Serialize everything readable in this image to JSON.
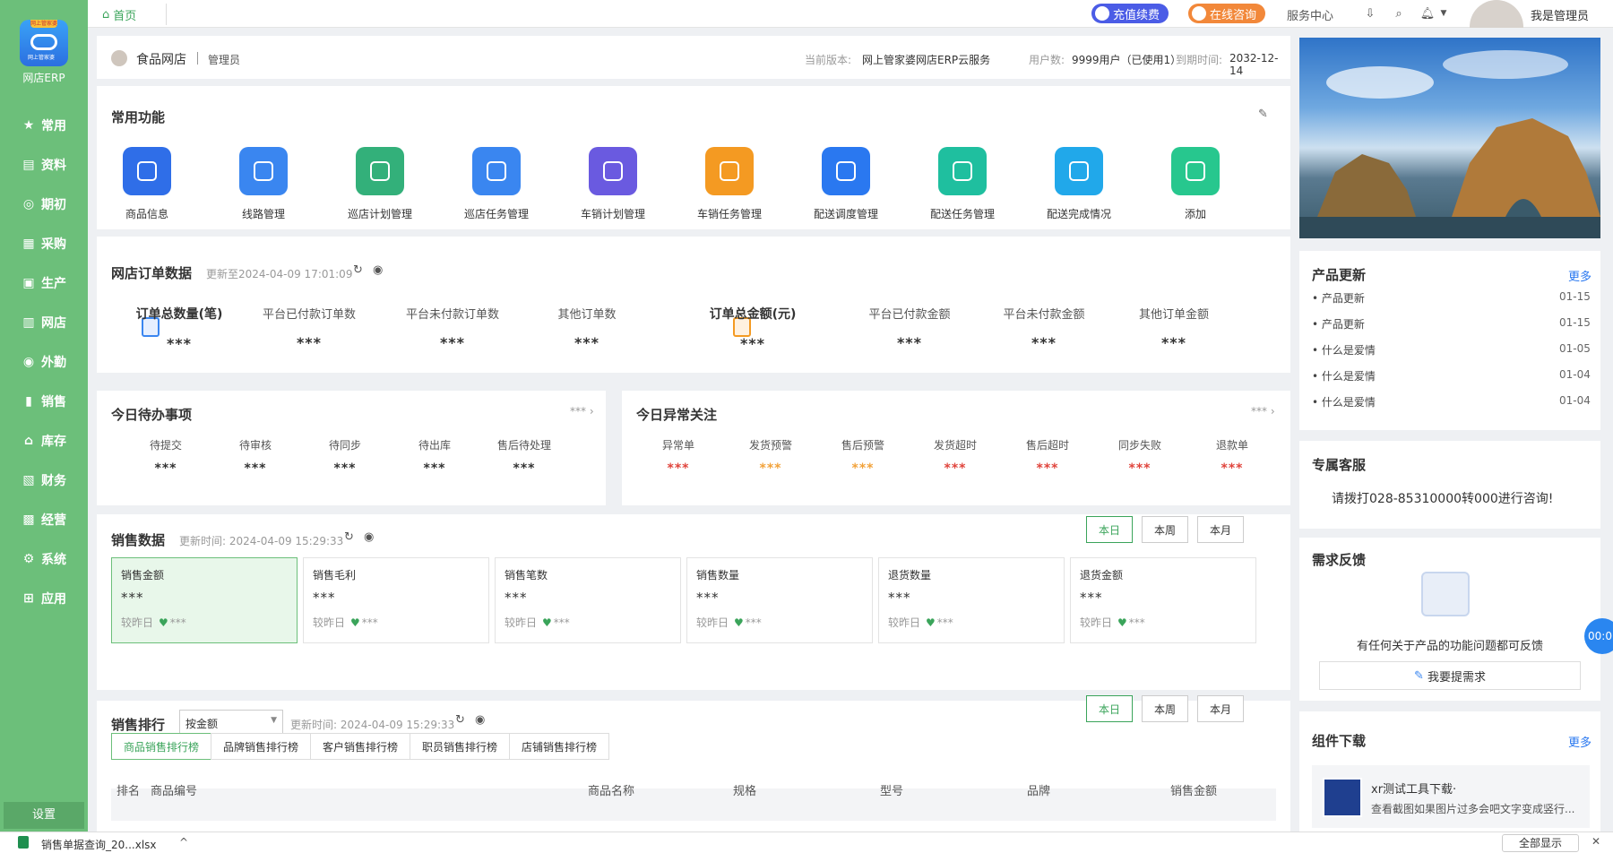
{
  "sidebar": {
    "logo_ribbon": "网上管家婆",
    "logo_tag": "网上管家婆",
    "logo_text": "网店ERP",
    "items": [
      {
        "label": "常用",
        "icon": "star-icon",
        "glyph": "★"
      },
      {
        "label": "资料",
        "icon": "document-icon",
        "glyph": "▤"
      },
      {
        "label": "期初",
        "icon": "target-icon",
        "glyph": "◎"
      },
      {
        "label": "采购",
        "icon": "list-icon",
        "glyph": "▦"
      },
      {
        "label": "生产",
        "icon": "factory-icon",
        "glyph": "▣"
      },
      {
        "label": "网店",
        "icon": "shop-icon",
        "glyph": "▥"
      },
      {
        "label": "外勤",
        "icon": "compass-icon",
        "glyph": "◉"
      },
      {
        "label": "销售",
        "icon": "bar-chart-icon",
        "glyph": "▮"
      },
      {
        "label": "库存",
        "icon": "warehouse-icon",
        "glyph": "⌂"
      },
      {
        "label": "财务",
        "icon": "ledger-icon",
        "glyph": "▧"
      },
      {
        "label": "经营",
        "icon": "briefcase-icon",
        "glyph": "▩"
      },
      {
        "label": "系统",
        "icon": "gear-icon",
        "glyph": "⚙"
      },
      {
        "label": "应用",
        "icon": "plus-square-icon",
        "glyph": "⊞"
      }
    ],
    "settings": "设置"
  },
  "topbar": {
    "home_tab": "首页",
    "recharge": "充值续费",
    "consult": "在线咨询",
    "service": "服务中心",
    "user": "我是管理员"
  },
  "info": {
    "shop": "食品网店",
    "role": "管理员",
    "version_label": "当前版本:",
    "version": "网上管家婆网店ERP云服务",
    "users_label": "用户数:",
    "users": "9999用户（已使用1）",
    "expire_label": "到期时间:",
    "expire": "2032-12-14"
  },
  "functions": {
    "title": "常用功能",
    "items": [
      {
        "label": "商品信息",
        "color": "#2f6ee8"
      },
      {
        "label": "线路管理",
        "color": "#3a86f0"
      },
      {
        "label": "巡店计划管理",
        "color": "#33b07a"
      },
      {
        "label": "巡店任务管理",
        "color": "#3a86f0"
      },
      {
        "label": "车销计划管理",
        "color": "#6a5ae0"
      },
      {
        "label": "车销任务管理",
        "color": "#f49a22"
      },
      {
        "label": "配送调度管理",
        "color": "#2a78f0"
      },
      {
        "label": "配送任务管理",
        "color": "#1fbf9f"
      },
      {
        "label": "配送完成情况",
        "color": "#21a8ea"
      },
      {
        "label": "添加",
        "color": "#27c78e"
      }
    ]
  },
  "orders": {
    "title": "网店订单数据",
    "updated": "更新至2024-04-09 17:01:09",
    "stats": [
      {
        "label": "订单总数量(笔)",
        "value": "***"
      },
      {
        "label": "平台已付款订单数",
        "value": "***"
      },
      {
        "label": "平台未付款订单数",
        "value": "***"
      },
      {
        "label": "其他订单数",
        "value": "***"
      },
      {
        "label": "订单总金额(元)",
        "value": "***"
      },
      {
        "label": "平台已付款金额",
        "value": "***"
      },
      {
        "label": "平台未付款金额",
        "value": "***"
      },
      {
        "label": "其他订单金额",
        "value": "***"
      }
    ]
  },
  "todo": {
    "title": "今日待办事项",
    "more": "***",
    "items": [
      {
        "label": "待提交",
        "value": "***"
      },
      {
        "label": "待审核",
        "value": "***"
      },
      {
        "label": "待同步",
        "value": "***"
      },
      {
        "label": "待出库",
        "value": "***"
      },
      {
        "label": "售后待处理",
        "value": "***"
      }
    ]
  },
  "abnormal": {
    "title": "今日异常关注",
    "more": "***",
    "items": [
      {
        "label": "异常单",
        "value": "***",
        "color": "#e0443c"
      },
      {
        "label": "发货预警",
        "value": "***",
        "color": "#f2a23a"
      },
      {
        "label": "售后预警",
        "value": "***",
        "color": "#f2a23a"
      },
      {
        "label": "发货超时",
        "value": "***",
        "color": "#e0443c"
      },
      {
        "label": "售后超时",
        "value": "***",
        "color": "#e0443c"
      },
      {
        "label": "同步失败",
        "value": "***",
        "color": "#e0443c"
      },
      {
        "label": "退款单",
        "value": "***",
        "color": "#e0443c"
      }
    ]
  },
  "sales": {
    "title": "销售数据",
    "updated": "更新时间: 2024-04-09 15:29:33",
    "periods": [
      "本日",
      "本周",
      "本月"
    ],
    "cards": [
      {
        "label": "销售金额",
        "value": "***",
        "cmp": "较昨日",
        "delta": "***"
      },
      {
        "label": "销售毛利",
        "value": "***",
        "cmp": "较昨日",
        "delta": "***"
      },
      {
        "label": "销售笔数",
        "value": "***",
        "cmp": "较昨日",
        "delta": "***"
      },
      {
        "label": "销售数量",
        "value": "***",
        "cmp": "较昨日",
        "delta": "***"
      },
      {
        "label": "退货数量",
        "value": "***",
        "cmp": "较昨日",
        "delta": "***"
      },
      {
        "label": "退货金额",
        "value": "***",
        "cmp": "较昨日",
        "delta": "***"
      }
    ]
  },
  "ranking": {
    "title": "销售排行",
    "select": "按金额",
    "updated": "更新时间: 2024-04-09 15:29:33",
    "periods": [
      "本日",
      "本周",
      "本月"
    ],
    "tabs": [
      "商品销售排行榜",
      "品牌销售排行榜",
      "客户销售排行榜",
      "职员销售排行榜",
      "店铺销售排行榜"
    ],
    "columns": [
      "排名",
      "商品编号",
      "商品名称",
      "规格",
      "型号",
      "品牌",
      "销售金额"
    ]
  },
  "right": {
    "updates_title": "产品更新",
    "updates_more": "更多",
    "updates": [
      {
        "text": "• 产品更新",
        "date": "01-15"
      },
      {
        "text": "• 产品更新",
        "date": "01-15"
      },
      {
        "text": "• 什么是爱情",
        "date": "01-05"
      },
      {
        "text": "• 什么是爱情",
        "date": "01-04"
      },
      {
        "text": "• 什么是爱情",
        "date": "01-04"
      }
    ],
    "service_title": "专属客服",
    "service_text": "请拨打028-85310000转000进行咨询!",
    "feedback_title": "需求反馈",
    "feedback_text": "有任何关于产品的功能问题都可反馈",
    "feedback_btn": "我要提需求",
    "widget_title": "组件下载",
    "widget_more": "更多",
    "widget_name": "xr测试工具下载·",
    "widget_desc": "查看截图如果图片过多会吧文字变成竖行...",
    "float_badge": "00:0"
  },
  "download_bar": {
    "file": "销售单据查询_20...xlsx",
    "show_all": "全部显示"
  }
}
